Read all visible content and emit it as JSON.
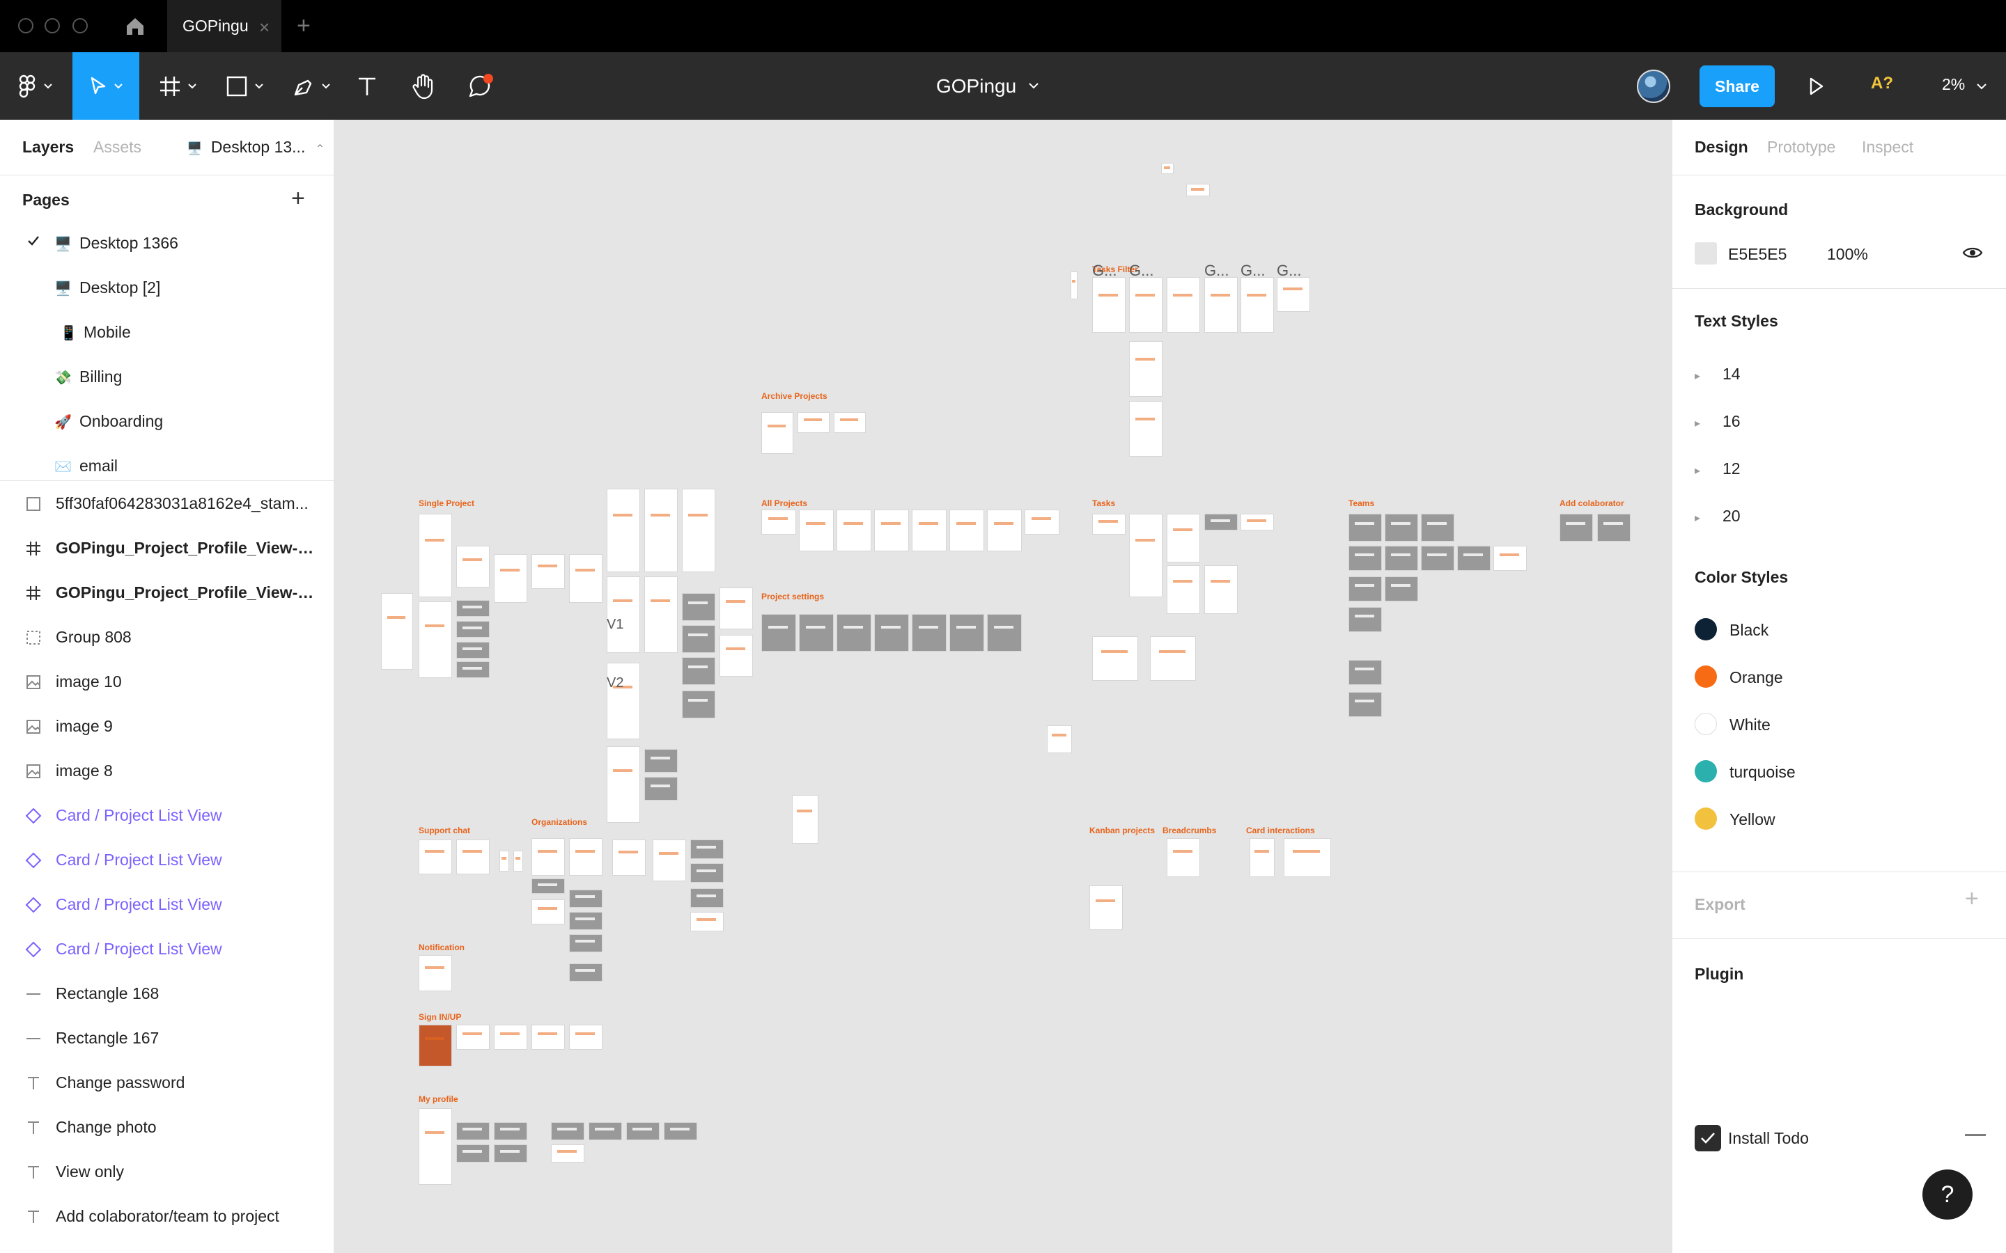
{
  "titlebar": {
    "tab_label": "GOPingu"
  },
  "toolbar": {
    "doc_title": "GOPingu",
    "share_label": "Share",
    "a11y_label": "A?",
    "zoom_label": "2%"
  },
  "left_panel": {
    "tabs": [
      "Layers",
      "Assets"
    ],
    "page_switcher": "Desktop 13...",
    "pages_title": "Pages",
    "pages": [
      {
        "emoji": "🖥️",
        "label": "Desktop 1366",
        "checked": true
      },
      {
        "emoji": "🖥️",
        "label": "Desktop [2]"
      },
      {
        "emoji": "📱",
        "label": "Mobile"
      },
      {
        "emoji": "💸",
        "label": "Billing"
      },
      {
        "emoji": "🚀",
        "label": "Onboarding"
      },
      {
        "emoji": "✉️",
        "label": "email"
      }
    ],
    "layers": [
      {
        "type": "rect",
        "label": "5ff30faf064283031a8162e4_stam..."
      },
      {
        "type": "frame",
        "label": "GOPingu_Project_Profile_View-on..."
      },
      {
        "type": "frame",
        "label": "GOPingu_Project_Profile_View-on..."
      },
      {
        "type": "group",
        "label": "Group 808"
      },
      {
        "type": "image",
        "label": "image 10"
      },
      {
        "type": "image",
        "label": "image 9"
      },
      {
        "type": "image",
        "label": "image 8"
      },
      {
        "type": "component",
        "label": "Card / Project List View"
      },
      {
        "type": "component",
        "label": "Card / Project List View"
      },
      {
        "type": "component",
        "label": "Card / Project List View"
      },
      {
        "type": "component",
        "label": "Card / Project List View"
      },
      {
        "type": "line",
        "label": "Rectangle 168"
      },
      {
        "type": "line",
        "label": "Rectangle 167"
      },
      {
        "type": "text",
        "label": "Change password"
      },
      {
        "type": "text",
        "label": "Change photo"
      },
      {
        "type": "text",
        "label": "View only"
      },
      {
        "type": "text",
        "label": "Add colaborator/team to project"
      }
    ]
  },
  "right_panel": {
    "tabs": [
      "Design",
      "Prototype",
      "Inspect"
    ],
    "background": {
      "title": "Background",
      "hex": "E5E5E5",
      "opacity": "100%"
    },
    "text_styles": {
      "title": "Text Styles",
      "items": [
        "14",
        "16",
        "12",
        "20"
      ]
    },
    "color_styles": {
      "title": "Color Styles",
      "items": [
        {
          "label": "Black",
          "color": "#0e2236"
        },
        {
          "label": "Orange",
          "color": "#f76b15"
        },
        {
          "label": "White",
          "color": "#ffffff"
        },
        {
          "label": "turquoise",
          "color": "#2bb0ad"
        },
        {
          "label": "Yellow",
          "color": "#f2c23e"
        }
      ]
    },
    "export_title": "Export",
    "plugin": {
      "title": "Plugin",
      "item": "Install Todo"
    }
  },
  "canvas": {
    "labels": {
      "tasks_filter": "Tasks Filter",
      "archive_projects": "Archive Projects",
      "single_project": "Single Project",
      "all_projects": "All Projects",
      "tasks": "Tasks",
      "teams": "Teams",
      "add_collaborator": "Add colaborator",
      "project_settings": "Project settings",
      "support_chat": "Support chat",
      "organizations": "Organizations",
      "kanban_projects": "Kanban projects",
      "breadcrumbs": "Breadcrumbs",
      "card_interactions": "Card interactions",
      "notification": "Notification",
      "sign_in_up": "Sign IN/UP",
      "my_profile": "My profile",
      "v1": "V1",
      "v2": "V2",
      "g": "G..."
    }
  },
  "help_label": "?"
}
